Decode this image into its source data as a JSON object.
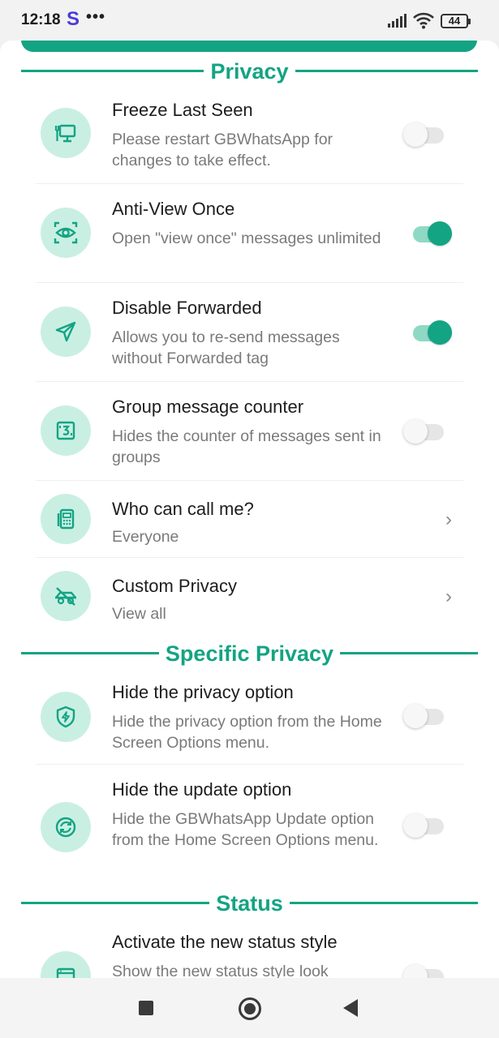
{
  "status_bar": {
    "time": "12:18",
    "app_badge": "S",
    "more": "•••",
    "battery": "44"
  },
  "sections": {
    "privacy": "Privacy",
    "specific_privacy": "Specific Privacy",
    "status": "Status"
  },
  "rows": [
    {
      "title": "Freeze Last Seen",
      "subtitle": "Please restart GBWhatsApp for changes to take effect.",
      "control": "switch",
      "on": false,
      "icon": "monitor-icon"
    },
    {
      "title": "Anti-View Once",
      "subtitle": "Open \"view once\" messages unlimited",
      "control": "switch",
      "on": true,
      "icon": "eye-scan-icon"
    },
    {
      "title": "Disable Forwarded",
      "subtitle": "Allows you to re-send messages without Forwarded tag",
      "control": "switch",
      "on": true,
      "icon": "send-icon"
    },
    {
      "title": "Group message counter",
      "subtitle": "Hides the counter of messages sent in groups",
      "control": "switch",
      "on": false,
      "icon": "counter-icon"
    },
    {
      "title": "Who can call me?",
      "subtitle": "Everyone",
      "control": "chevron",
      "icon": "phone-icon"
    },
    {
      "title": "Custom Privacy",
      "subtitle": "View all",
      "control": "chevron",
      "icon": "hidden-icon"
    },
    {
      "title": "Hide the privacy option",
      "subtitle": "Hide the privacy option from the Home Screen Options menu.",
      "control": "switch",
      "on": false,
      "icon": "shield-icon"
    },
    {
      "title": "Hide the update option",
      "subtitle": "Hide the GBWhatsApp Update option from the Home Screen Options menu.",
      "control": "switch",
      "on": false,
      "icon": "update-icon"
    },
    {
      "title": "Activate the new status style",
      "subtitle": "Show the new status style look",
      "control": "switch",
      "on": false,
      "icon": "status-icon"
    }
  ],
  "colors": {
    "accent": "#13a483",
    "icon_bg": "#c9efe3"
  }
}
